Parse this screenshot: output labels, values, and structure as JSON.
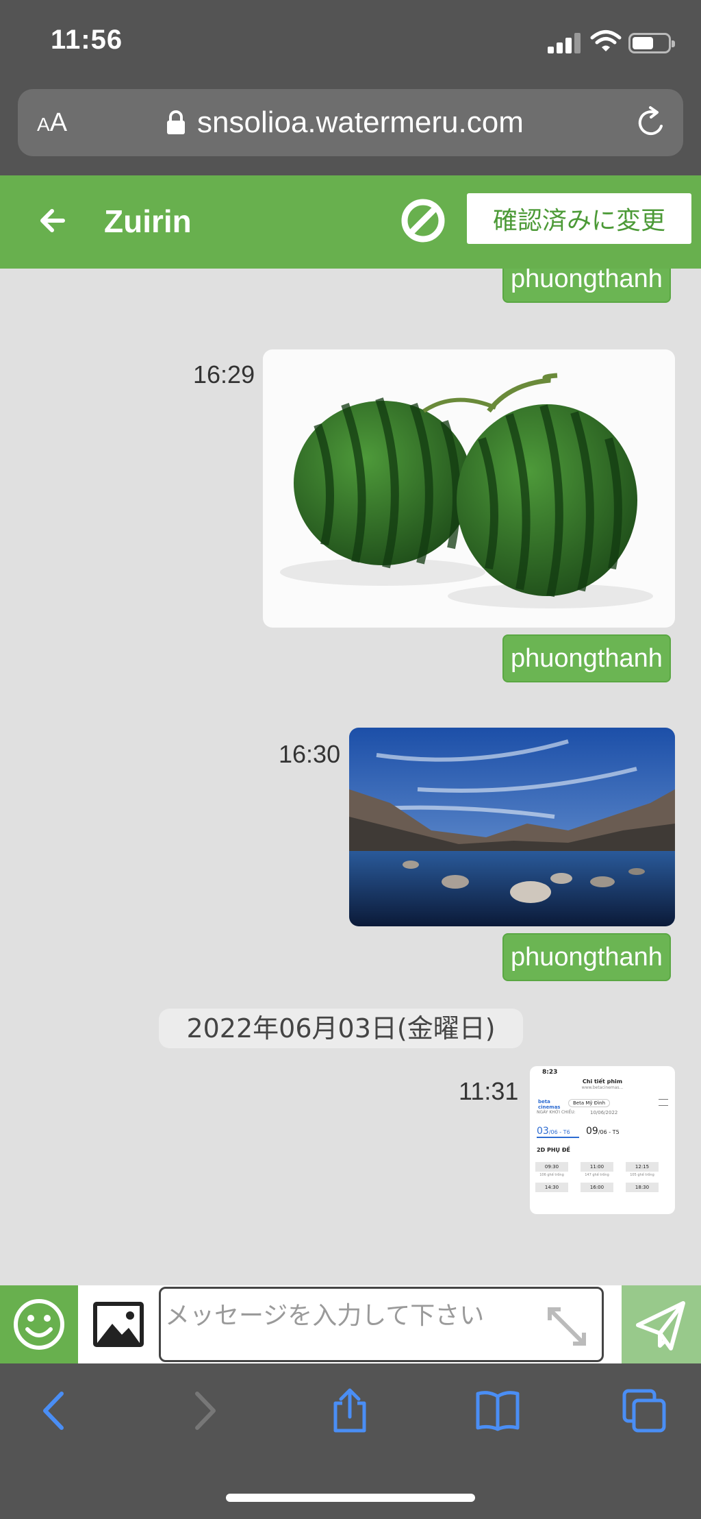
{
  "status_bar": {
    "time": "11:56"
  },
  "browser": {
    "text_size_label": "AA",
    "host": "snsolioa.watermeru.com"
  },
  "header": {
    "title": "Zuirin",
    "confirm_label": "確認済みに変更"
  },
  "chat": {
    "messages": [
      {
        "sender": "phuongthanh"
      },
      {
        "time": "16:29",
        "image": "watermelons-photo",
        "sender": "phuongthanh"
      },
      {
        "time": "16:30",
        "image": "lake-mountains-photo",
        "sender": "phuongthanh"
      }
    ],
    "date_separator": "2022年06月03日(金曜日)",
    "last_message": {
      "time": "11:31",
      "image": "cinema-screenshot"
    },
    "screenshot_thumb": {
      "time": "8:23",
      "page_title": "Chi tiết phim",
      "page_url": "www.betacinemas...",
      "brand": "beta cinemas",
      "location": "Beta Mỹ Đình",
      "release_label": "NGÀY KHỞI CHIẾU:",
      "release_date": "10/06/2022",
      "date1_day": "03",
      "date1_rest": "/06 - T6",
      "date2_day": "09",
      "date2_rest": "/06 - T5",
      "format_label": "2D PHỤ ĐỀ",
      "showtimes": [
        "09:30",
        "11:00",
        "12:15"
      ],
      "seats": [
        "106 ghế trống",
        "147 ghế trống",
        "105 ghế trống"
      ],
      "showtimes2": [
        "14:30",
        "16:00",
        "18:30"
      ]
    }
  },
  "composer": {
    "placeholder": "メッセージを入力して下さい"
  },
  "colors": {
    "header_green": "#68b04e",
    "tag_green": "#6bb553",
    "send_green": "#98c98b",
    "chat_bg": "#e0e0e0",
    "ios_blue": "#4a8ef5"
  }
}
